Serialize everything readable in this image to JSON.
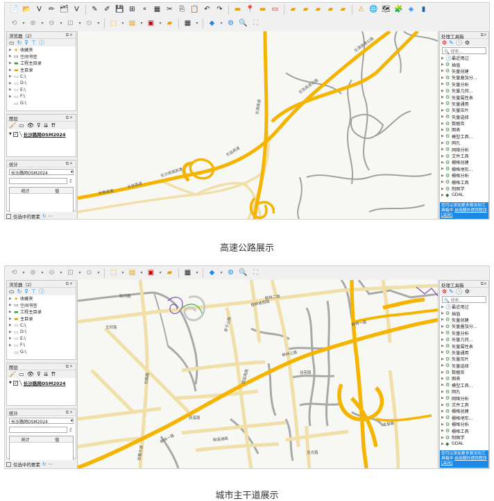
{
  "captions": {
    "first": "高速公路展示",
    "second": "城市主干道展示"
  },
  "browser": {
    "title": "浏览器（2）",
    "items": [
      {
        "label": "收藏夹",
        "icon": "star-icon"
      },
      {
        "label": "空间书签",
        "icon": "bookmark-icon"
      },
      {
        "label": "工程主目录",
        "icon": "folder-icon"
      },
      {
        "label": "主目录",
        "icon": "home-folder-icon"
      },
      {
        "label": "C:\\",
        "icon": "drive-icon"
      },
      {
        "label": "D:\\",
        "icon": "drive-icon"
      },
      {
        "label": "E:\\",
        "icon": "drive-icon"
      },
      {
        "label": "F:\\",
        "icon": "drive-icon"
      },
      {
        "label": "G:\\",
        "icon": "drive-icon"
      }
    ]
  },
  "layers": {
    "title": "图层",
    "layer_name": "长沙路网OSM2024"
  },
  "statistics": {
    "title": "统计",
    "selected_layer": "长沙路网OSM2024",
    "col_stat": "统计",
    "col_value": "值"
  },
  "selection_only": "仅选中的要素",
  "processing": {
    "title": "处理工具箱",
    "search_placeholder": "搜索...",
    "items": [
      "最近用过",
      "插值",
      "矢量创建",
      "矢量叠加分...",
      "矢量分析",
      "矢量几何...",
      "矢量属性表",
      "矢量通用",
      "矢量压片",
      "矢量选择",
      "数据库",
      "图表",
      "模型工具...",
      "网孔",
      "网络分析",
      "文件工具",
      "栅格创建",
      "栅格地形...",
      "栅格分析",
      "栅格工具",
      "制图学",
      "GDAL"
    ],
    "footer_text": "您可以添加更多算法到工具箱中",
    "footer_link1": "启用额外",
    "footer_link2": "提供程序",
    "footer_link3": "[关闭]"
  },
  "map1_labels": [
    "长株高速",
    "长张高速",
    "长沙绕城高速",
    "长益高速",
    "长湘高速",
    "长张高速公路",
    "长湘高速公路",
    "长浏高速"
  ],
  "map2_labels": [
    "新河路",
    "枫林二路",
    "枫林三路",
    "枫林一路",
    "银盆南路",
    "麓山南路",
    "桐梓坡西路",
    "岳华路",
    "梅溪湖路",
    "金星路",
    "西二环",
    "文轩路",
    "杜鹃路",
    "红枫路",
    "茶子山路",
    "谷苑路",
    "含光路",
    "涧溪路",
    "梅溪湖大道",
    "金华路",
    "岳麓大道"
  ],
  "colors": {
    "motorway": "#f4b400",
    "trunk": "#f5e6b5",
    "secondary": "#a0a0a0",
    "background": "#f7f7f4",
    "panel_footer": "#1e88e5"
  }
}
